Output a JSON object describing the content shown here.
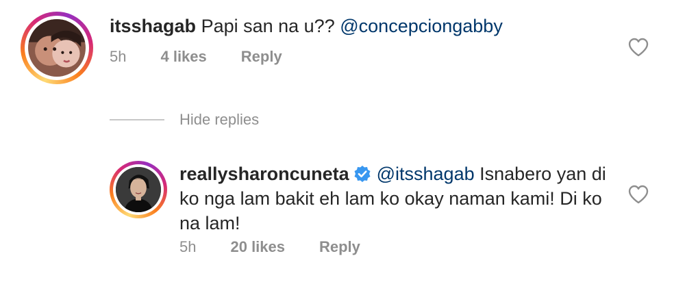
{
  "comments": [
    {
      "username": "itsshagab",
      "text": "Papi san na u??",
      "mention": "@concepciongabby",
      "time": "5h",
      "likes": "4 likes",
      "reply_label": "Reply",
      "verified": false
    },
    {
      "username": "reallysharoncuneta",
      "mention": "@itsshagab",
      "text_line1": "Isnabero yan di",
      "text_line2": "ko nga lam bakit eh lam ko okay naman kami! Di ko",
      "text_line3": "na lam!",
      "time": "5h",
      "likes": "20 likes",
      "reply_label": "Reply",
      "verified": true
    }
  ],
  "hide_replies_label": "Hide replies",
  "colors": {
    "text": "#262626",
    "meta": "#8e8e8e",
    "mention": "#00376b",
    "verified": "#3897f0"
  }
}
